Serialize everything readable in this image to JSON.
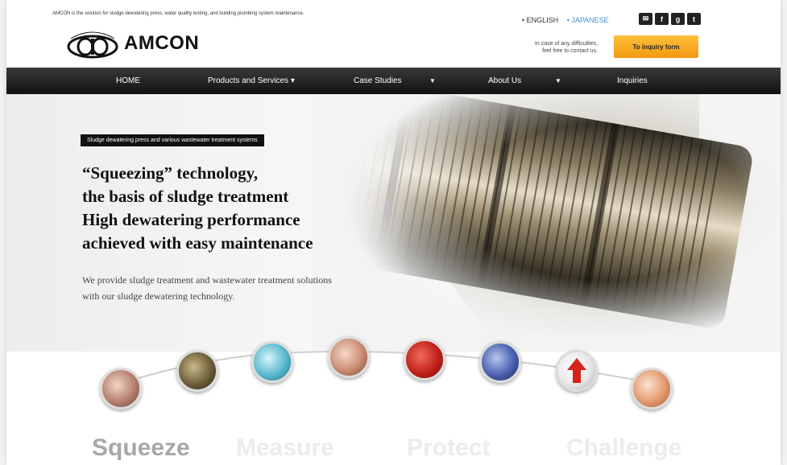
{
  "header": {
    "tagline": "AMCON is the solution for sludge dewatering press, water quality testing, and building plumbing system maintenance.",
    "logo_text": "AMCON",
    "lang_english": "• ENGLISH",
    "lang_japanese": "• JAPANESE",
    "social_icons": [
      "mail-icon",
      "facebook-icon",
      "google-plus-icon",
      "twitter-icon"
    ],
    "contact_line1": "In case of any difficulties,",
    "contact_line2": "feel free to contact us.",
    "inquiry_button": "To inquiry form"
  },
  "nav": {
    "home": "HOME",
    "products": "Products and Services ▾",
    "case_studies": "Case Studies",
    "about": "About Us",
    "inquiries": "Inquiries"
  },
  "hero": {
    "label": "Sludge dewatering press and various wastewater treatment systems",
    "headline_1": "“Squeezing” technology,",
    "headline_2": "the basis of sludge treatment",
    "headline_3": "High dewatering performance",
    "headline_4": "achieved with easy maintenance",
    "sub_1": "We provide sludge treatment and wastewater treatment solutions",
    "sub_2": "with our sludge dewatering technology."
  },
  "features": {
    "squeeze": "Squeeze",
    "measure": "Measure",
    "protect": "Protect",
    "challenge": "Challenge"
  },
  "colors": {
    "accent": "#f39a10",
    "nav_bg": "#1a1a1a",
    "link_blue": "#4a8fd0"
  }
}
